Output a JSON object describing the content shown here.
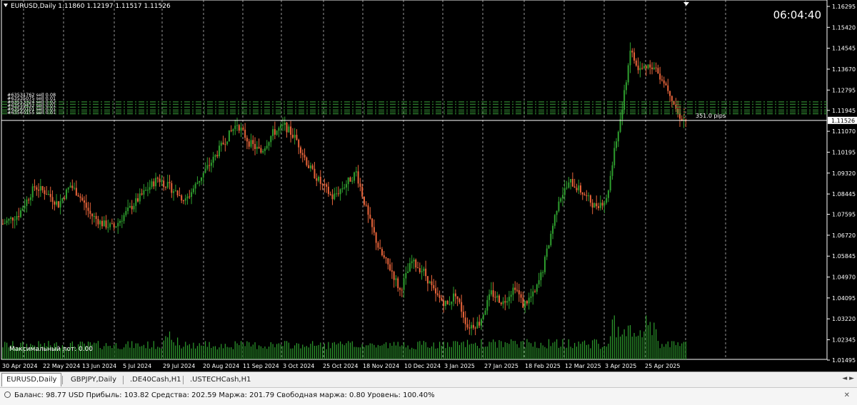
{
  "chart": {
    "header": "EURUSD,Daily  1.11860 1.12197 1.11517 1.11526",
    "clock": "06:04:40",
    "max_lot_label": "Максимальный лот: 0.00",
    "pips_label": "351.0 pips",
    "current_price": "1.11526",
    "price_labels": [
      "1.16295",
      "1.15420",
      "1.14545",
      "1.13670",
      "1.12795",
      "1.11945",
      "1.11070",
      "1.10195",
      "1.09320",
      "1.08445",
      "1.07595",
      "1.06720",
      "1.05845",
      "1.04970",
      "1.04095",
      "1.03220",
      "1.02345",
      "1.01495"
    ],
    "date_labels": [
      "30 Apr 2024",
      "22 May 2024",
      "13 Jun 2024",
      "5 Jul 2024",
      "29 Jul 2024",
      "20 Aug 2024",
      "11 Sep 2024",
      "3 Oct 2024",
      "25 Oct 2024",
      "18 Nov 2024",
      "10 Dec 2024",
      "3 Jan 2025",
      "27 Jan 2025",
      "18 Feb 2025",
      "12 Mar 2025",
      "3 Apr 2025",
      "25 Apr 2025"
    ],
    "order_labels": [
      "#63531762 sell 0.08",
      "#63535075 sell 0.01",
      "#63553324 sell 0.02",
      "#63559432 sell 0.01",
      "#63560101 sell 0.01",
      "#63560155 sell 0.01"
    ],
    "colors": {
      "bull": "#2e9e2e",
      "bear": "#e8643a",
      "grid": "#c8c8c8",
      "order_line": "#3aa03a",
      "volume": "#2e9e2e",
      "price_line": "#ffffff"
    },
    "price_range": [
      1.01495,
      1.16295
    ],
    "anchor_points": [
      [
        0,
        1.072
      ],
      [
        8,
        1.076
      ],
      [
        16,
        1.0875
      ],
      [
        22,
        1.085
      ],
      [
        28,
        1.08
      ],
      [
        34,
        1.088
      ],
      [
        38,
        1.0845
      ],
      [
        44,
        1.076
      ],
      [
        50,
        1.072
      ],
      [
        56,
        1.0705
      ],
      [
        62,
        1.0765
      ],
      [
        70,
        1.084
      ],
      [
        78,
        1.091
      ],
      [
        86,
        1.086
      ],
      [
        92,
        1.0815
      ],
      [
        100,
        1.092
      ],
      [
        106,
        1.099
      ],
      [
        112,
        1.107
      ],
      [
        118,
        1.114
      ],
      [
        124,
        1.106
      ],
      [
        130,
        1.102
      ],
      [
        136,
        1.11
      ],
      [
        142,
        1.113
      ],
      [
        148,
        1.107
      ],
      [
        154,
        1.096
      ],
      [
        160,
        1.089
      ],
      [
        166,
        1.083
      ],
      [
        172,
        1.088
      ],
      [
        178,
        1.0935
      ],
      [
        184,
        1.075
      ],
      [
        190,
        1.06
      ],
      [
        196,
        1.052
      ],
      [
        200,
        1.044
      ],
      [
        206,
        1.056
      ],
      [
        212,
        1.052
      ],
      [
        218,
        1.042
      ],
      [
        224,
        1.038
      ],
      [
        228,
        1.043
      ],
      [
        234,
        1.029
      ],
      [
        240,
        1.0305
      ],
      [
        246,
        1.043
      ],
      [
        252,
        1.039
      ],
      [
        258,
        1.046
      ],
      [
        262,
        1.038
      ],
      [
        268,
        1.043
      ],
      [
        272,
        1.053
      ],
      [
        280,
        1.0825
      ],
      [
        286,
        1.0895
      ],
      [
        292,
        1.085
      ],
      [
        298,
        1.0795
      ],
      [
        304,
        1.082
      ],
      [
        308,
        1.102
      ],
      [
        312,
        1.12
      ],
      [
        316,
        1.145
      ],
      [
        320,
        1.136
      ],
      [
        326,
        1.139
      ],
      [
        332,
        1.133
      ],
      [
        336,
        1.127
      ],
      [
        340,
        1.118
      ],
      [
        343,
        1.1153
      ]
    ]
  },
  "tabs": [
    "EURUSD,Daily",
    "GBPJPY,Daily",
    ".DE40Cash,H1",
    ".USTECHCash,H1"
  ],
  "tabs_nav": "◄ ►",
  "status": {
    "text": "Баланс: 98.77 USD  Прибыль: 103.82  Средства: 202.59  Маржа: 201.79  Свободная маржа: 0.80  Уровень: 100.40%",
    "close": "✕"
  }
}
